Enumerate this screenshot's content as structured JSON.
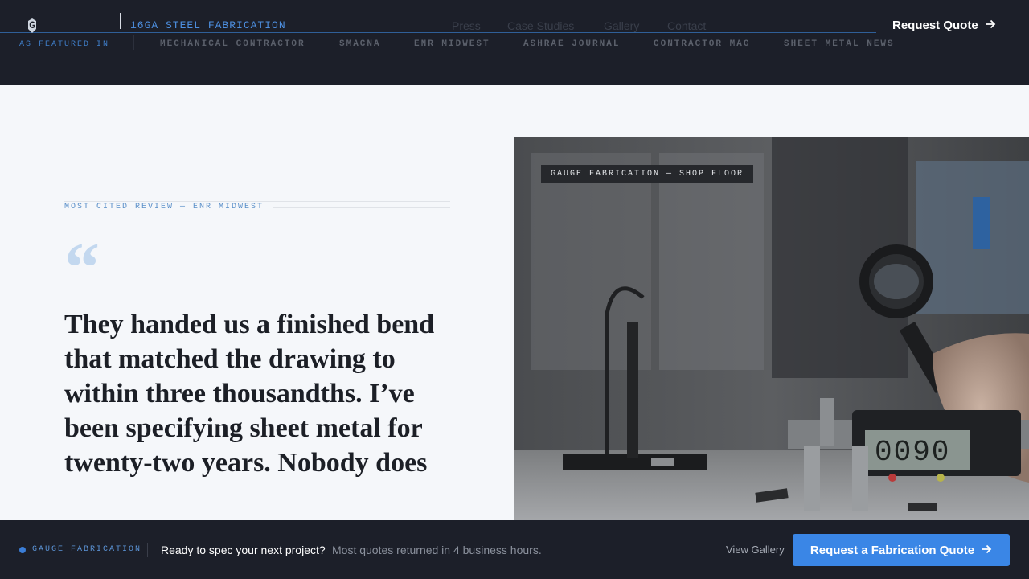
{
  "header": {
    "logo_icon": "gauge-g-logo",
    "tagline": "16GA STEEL FABRICATION",
    "nav": [
      "Press",
      "Case Studies",
      "Gallery",
      "Contact"
    ],
    "cta_label": "Request Quote",
    "cta_icon": "arrow-right-icon"
  },
  "press": {
    "label": "AS FEATURED IN",
    "items": [
      "MECHANICAL CONTRACTOR",
      "SMACNA",
      "ENR MIDWEST",
      "ASHRAE JOURNAL",
      "CONTRACTOR MAG",
      "SHEET METAL NEWS"
    ]
  },
  "testimonial": {
    "eyebrow": "MOST CITED REVIEW — ENR MIDWEST",
    "quote_mark": "“",
    "quote": "They handed us a finished bend that matched the drawing to within three thousandths. I’ve been specifying sheet metal for twenty-two years. Nobody does"
  },
  "photo": {
    "label": "GAUGE FABRICATION — SHOP FLOOR"
  },
  "bottom_bar": {
    "brand": "GAUGE FABRICATION",
    "headline": "Ready to spec your next project?",
    "subtext": "Most quotes returned in 4 business hours.",
    "gallery_link": "View Gallery",
    "cta_label": "Request a Fabrication Quote",
    "cta_icon": "arrow-right-icon"
  },
  "colors": {
    "header_bg": "#1c1f29",
    "accent_blue": "#3a86e6",
    "page_bg": "#f5f7fa"
  }
}
